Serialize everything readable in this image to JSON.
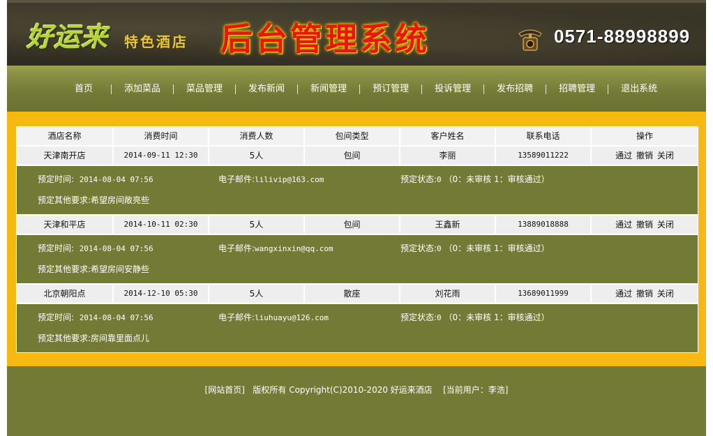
{
  "header": {
    "logo_main": "好运来",
    "logo_sub": "特色酒店",
    "system_title": "后台管理系统",
    "phone": "0571-88998899"
  },
  "nav": {
    "items": [
      "首页",
      "添加菜品",
      "菜品管理",
      "发布新闻",
      "新闻管理",
      "预订管理",
      "投诉管理",
      "发布招聘",
      "招聘管理",
      "退出系统"
    ]
  },
  "table": {
    "columns": [
      "酒店名称",
      "消费时间",
      "消费人数",
      "包间类型",
      "客户姓名",
      "联系电话",
      "操作"
    ],
    "labels": {
      "booking_time": "预定时间:",
      "email": "电子邮件:",
      "status": "预定状态:",
      "status_note": "（0：未审核 1：审核通过）",
      "other": "预定其他要求:"
    },
    "actions": [
      "通过",
      "撤销",
      "关闭"
    ],
    "rows": [
      {
        "hotel": "天津南开店",
        "time": "2014-09-11 12:30",
        "people": "5人",
        "room": "包间",
        "customer": "李丽",
        "phone": "13589011222",
        "booking_time": "2014-08-04 07:56",
        "email": "lilivip@163.com",
        "status": "0",
        "other": "希望房间敞亮些"
      },
      {
        "hotel": "天津和平店",
        "time": "2014-10-11 02:30",
        "people": "5人",
        "room": "包间",
        "customer": "王鑫新",
        "phone": "13889018888",
        "booking_time": "2014-08-04 07:56",
        "email": "wangxinxin@qq.com",
        "status": "0",
        "other": "希望房间安静些"
      },
      {
        "hotel": "北京朝阳点",
        "time": "2014-12-10 05:30",
        "people": "5人",
        "room": "散座",
        "customer": "刘花雨",
        "phone": "13689011999",
        "booking_time": "2014-08-04 07:56",
        "email": "liuhuayu@126.com",
        "status": "0",
        "other": "房间靠里面点儿"
      }
    ]
  },
  "footer": {
    "home_link": "[网站首页]",
    "copyright": "版权所有 Copyright(C)2010-2020 好运来酒店",
    "current_user": "[当前用户：李浩]"
  },
  "colors": {
    "olive": "#737a36",
    "band": "#f5b90f",
    "title_red": "#e8160c"
  }
}
